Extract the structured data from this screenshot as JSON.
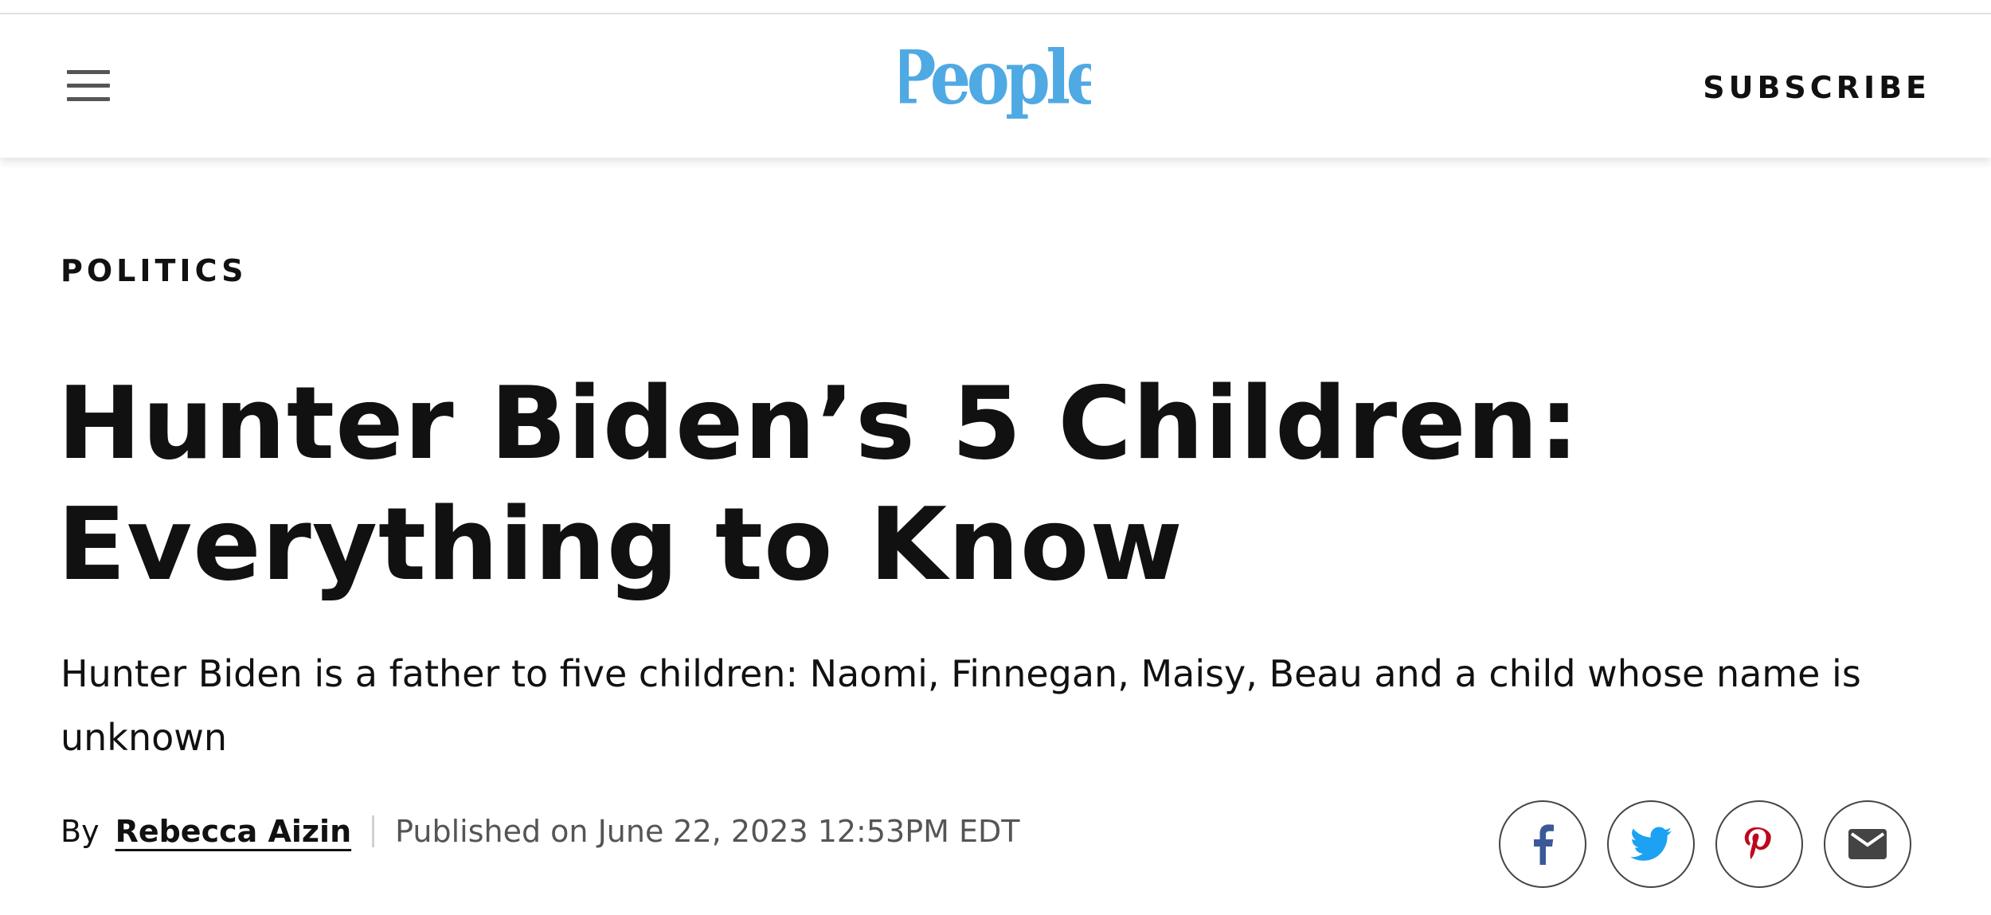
{
  "header": {
    "logo_text": "People",
    "subscribe_label": "SUBSCRIBE",
    "logo_color": "#4fa9e3"
  },
  "article": {
    "category": "POLITICS",
    "headline": "Hunter Biden’s 5 Children: Everything to Know",
    "dek": "Hunter Biden is a father to five children: Naomi, Finnegan, Maisy, Beau and a child whose name is unknown",
    "byline_prefix": "By",
    "author": "Rebecca Aizin",
    "published": "Published on June 22, 2023 12:53PM EDT"
  },
  "share": {
    "icons": [
      "facebook-icon",
      "twitter-icon",
      "pinterest-icon",
      "email-icon"
    ],
    "colors": {
      "facebook": "#3b5998",
      "twitter": "#1da1f2",
      "pinterest": "#bd081c",
      "email": "#444444"
    }
  }
}
